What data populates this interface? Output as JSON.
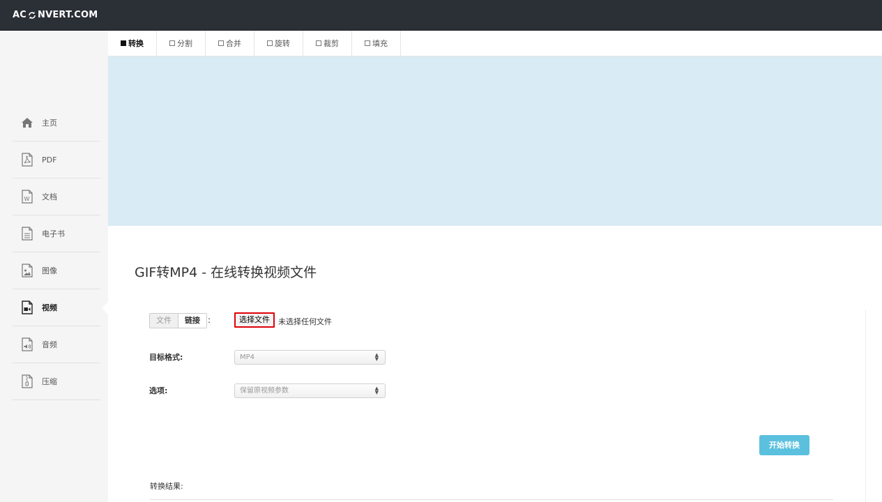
{
  "header": {
    "logo_left": "AC",
    "logo_right": "NVERT.COM",
    "logo_icon": "refresh-icon"
  },
  "sidebar": {
    "items": [
      {
        "label": "主页",
        "icon": "home-icon"
      },
      {
        "label": "PDF",
        "icon": "pdf-file-icon"
      },
      {
        "label": "文档",
        "icon": "word-file-icon"
      },
      {
        "label": "电子书",
        "icon": "ebook-file-icon"
      },
      {
        "label": "图像",
        "icon": "image-file-icon"
      },
      {
        "label": "视频",
        "icon": "video-file-icon"
      },
      {
        "label": "音频",
        "icon": "audio-file-icon"
      },
      {
        "label": "压缩",
        "icon": "archive-file-icon"
      }
    ],
    "active_index": 5
  },
  "tabs": [
    {
      "label": "转换"
    },
    {
      "label": "分割"
    },
    {
      "label": "合并"
    },
    {
      "label": "旋转"
    },
    {
      "label": "裁剪"
    },
    {
      "label": "填充"
    }
  ],
  "main": {
    "title": "GIF转MP4 - 在线转换视频文件",
    "source_toggle": {
      "file": "文件",
      "link": "链接",
      "colon": ":"
    },
    "file_button": "选择文件",
    "file_status": "未选择任何文件",
    "target_format_label": "目标格式:",
    "target_format_value": "MP4",
    "options_label": "选项:",
    "options_value": "保留原视频参数",
    "start_button": "开始转换",
    "result_label": "转换结果:"
  },
  "colors": {
    "topbar": "#2b2f36",
    "banner": "#d9ebf5",
    "start_button": "#5bc0de",
    "file_button_border": "#e0000a"
  }
}
